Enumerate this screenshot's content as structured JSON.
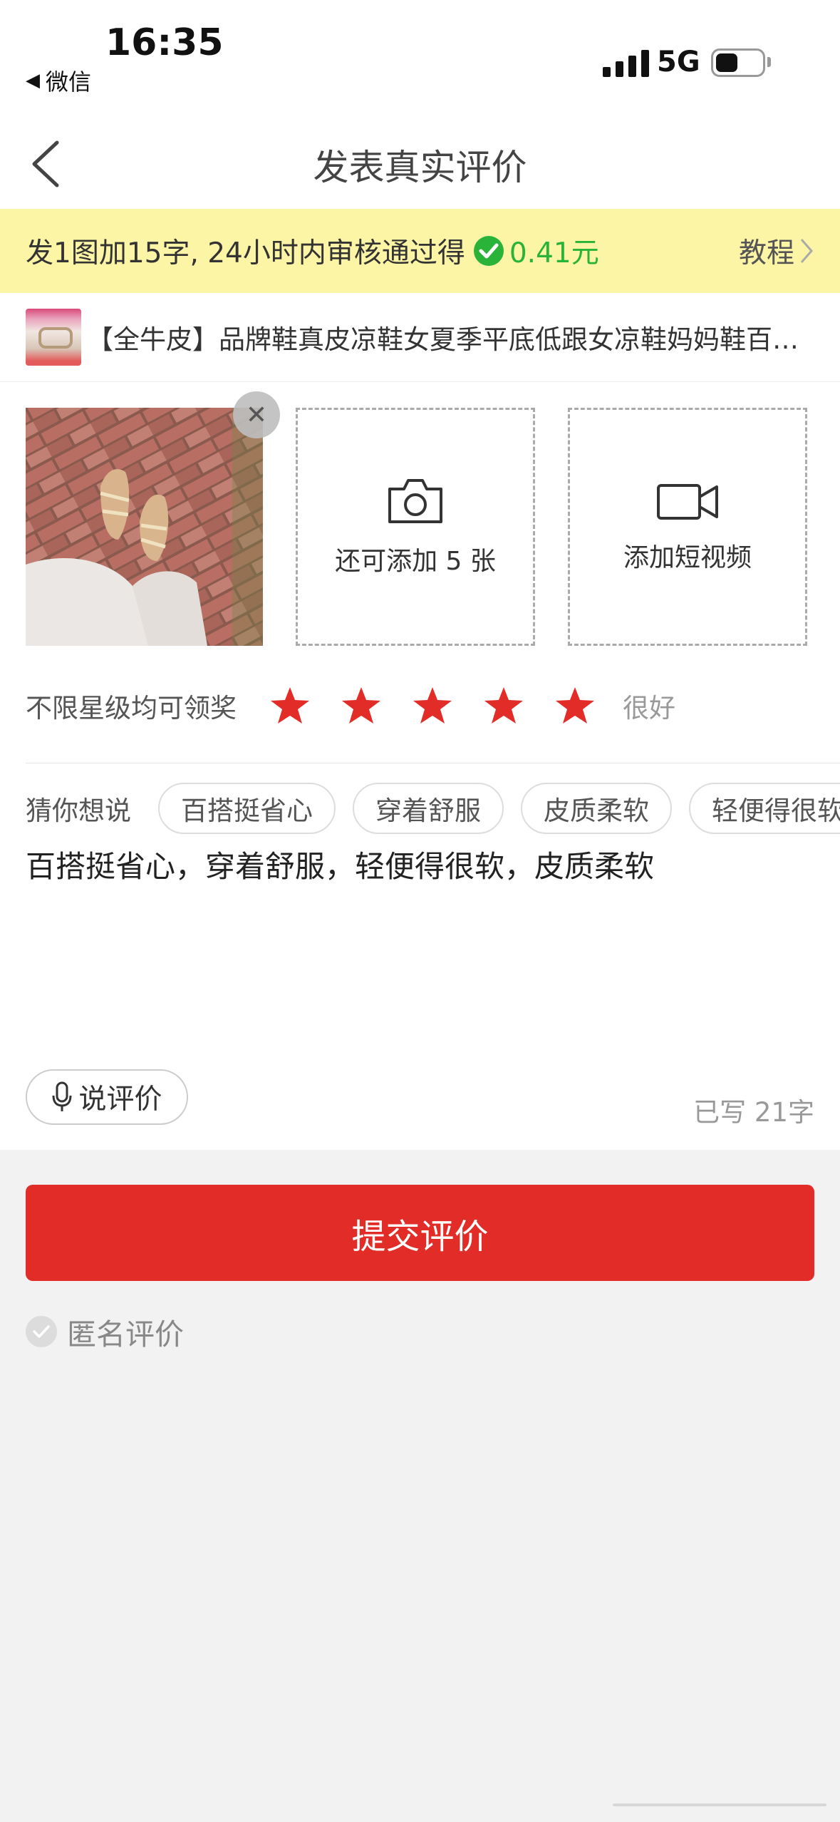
{
  "status_bar": {
    "time": "16:35",
    "back_app": "微信",
    "network": "5G"
  },
  "nav": {
    "title": "发表真实评价"
  },
  "banner": {
    "text": "发1图加15字, 24小时内审核通过得",
    "reward": "0.41元",
    "tutorial": "教程"
  },
  "product": {
    "title": "【全牛皮】品牌鞋真皮凉鞋女夏季平底低跟女凉鞋妈妈鞋百…"
  },
  "media": {
    "add_photo_label": "还可添加 5 张",
    "add_video_label": "添加短视频"
  },
  "rating": {
    "label": "不限星级均可领奖",
    "stars": 5,
    "max_stars": 5,
    "text": "很好",
    "star_color": "#e22c27"
  },
  "suggestions": {
    "label": "猜你想说",
    "chips": [
      "百搭挺省心",
      "穿着舒服",
      "皮质柔软",
      "轻便得很软"
    ]
  },
  "review": {
    "text": "百搭挺省心，穿着舒服，轻便得很软，皮质柔软",
    "word_count": "已写 21字"
  },
  "voice": {
    "label": "说评价"
  },
  "submit": {
    "label": "提交评价",
    "color": "#e22c27"
  },
  "anonymous": {
    "label": "匿名评价"
  },
  "icons": {
    "back": "chevron-left-icon",
    "wechat": "wechat-icon",
    "camera": "camera-icon",
    "video": "video-camera-icon",
    "mic": "microphone-icon",
    "close": "close-icon",
    "check": "check-icon"
  }
}
